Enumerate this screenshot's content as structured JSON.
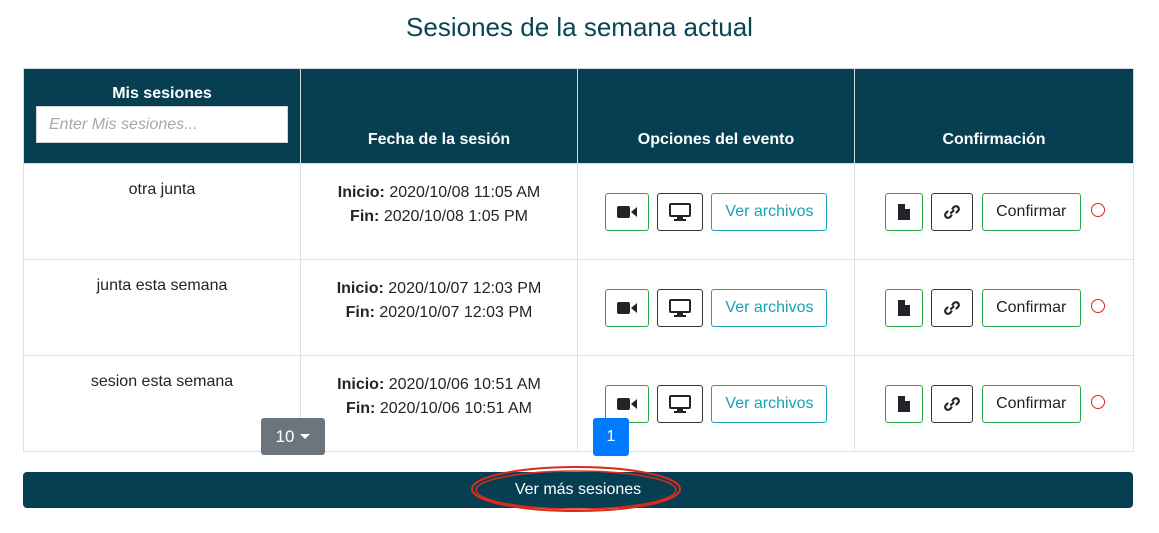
{
  "page": {
    "title": "Sesiones de la semana actual"
  },
  "table": {
    "headers": {
      "name": "Mis sesiones",
      "date": "Fecha de la sesión",
      "options": "Opciones del evento",
      "confirmation": "Confirmación"
    },
    "filter_placeholder": "Enter Mis sesiones...",
    "start_label": "Inicio:",
    "end_label": "Fin:",
    "files_label": "Ver archivos",
    "confirm_label": "Confirmar",
    "rows": [
      {
        "name": "otra junta",
        "start": "2020/10/08 11:05 AM",
        "end": "2020/10/08 1:05 PM"
      },
      {
        "name": "junta esta semana",
        "start": "2020/10/07 12:03 PM",
        "end": "2020/10/07 12:03 PM"
      },
      {
        "name": "sesion esta semana",
        "start": "2020/10/06 10:51 AM",
        "end": "2020/10/06 10:51 AM"
      }
    ]
  },
  "pagination": {
    "page_size": "10",
    "current_page": "1"
  },
  "footer": {
    "more_label": "Ver más sesiones"
  },
  "icons": {
    "video": "video-camera-icon",
    "screen": "monitor-icon",
    "document": "document-icon",
    "link": "link-icon",
    "status": "circle-outline-icon",
    "dropdown": "caret-down-icon"
  },
  "colors": {
    "header_bg": "#073f52",
    "title": "#0b4453",
    "video_border": "#28a745",
    "files_border": "#17a2b8",
    "page_active": "#007bff",
    "page_size_bg": "#6c757d",
    "status": "#e02020",
    "annotation": "#d92b1a"
  }
}
